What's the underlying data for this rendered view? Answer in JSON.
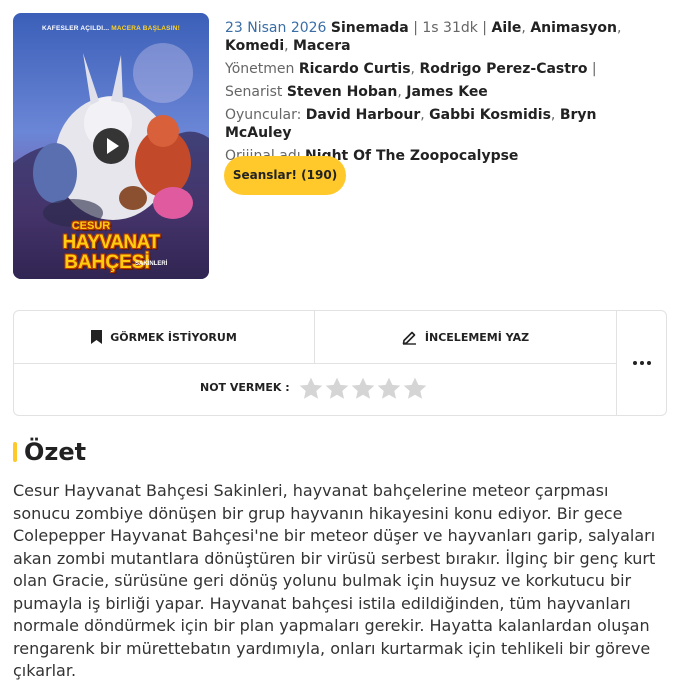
{
  "poster": {
    "tagline_part1": "KAFESLER AÇILDI...",
    "tagline_part2": "MACERA BAŞLASIN!",
    "title_line1": "CESUR",
    "title_line2": "HAYVANAT",
    "title_line3": "BAHÇESİ",
    "title_line4": "SAKİNLERİ"
  },
  "info": {
    "release_date": "23 Nisan 2026",
    "release_status": "Sinemada",
    "duration": "1s 31dk",
    "genres": [
      "Aile",
      "Animasyon",
      "Komedi",
      "Macera"
    ],
    "director_label": "Yönetmen",
    "directors": [
      "Ricardo Curtis",
      "Rodrigo Perez-Castro"
    ],
    "writer_label": "Senarist",
    "writers": [
      "Steven Hoban",
      "James Kee"
    ],
    "cast_label": "Oyuncular:",
    "cast": [
      "David Harbour",
      "Gabbi Kosmidis",
      "Bryn McAuley"
    ],
    "original_title_label": "Orijinal adı",
    "original_title": "Night Of The Zoopocalypse"
  },
  "seans_button": "Seanslar! (190)",
  "actions": {
    "watchlist": "GÖRMEK İSTİYORUM",
    "review": "İNCELEMEMİ YAZ",
    "rate_label": "NOT VERMEK :",
    "stars": 5
  },
  "summary": {
    "title": "Özet",
    "text": "Cesur Hayvanat Bahçesi Sakinleri, hayvanat bahçelerine meteor çarpması sonucu zombiye dönüşen bir grup hayvanın hikayesini konu ediyor. Bir gece Colepepper Hayvanat Bahçesi'ne bir meteor düşer ve hayvanları garip, salyaları akan zombi mutantlara dönüştüren bir virüsü serbest bırakır. İlginç bir genç kurt olan Gracie, sürüsüne geri dönüş yolunu bulmak için huysuz ve korkutucu bir pumayla iş birliği yapar. Hayvanat bahçesi istila edildiğinden, tüm hayvanları normale döndürmek için bir plan yapmaları gerekir. Hayatta kalanlardan oluşan rengarenk bir mürettebatın yardımıyla, onları kurtarmak için tehlikeli bir göreve çıkarlar."
  },
  "colors": {
    "accent": "#ffc92b",
    "date": "#3a6ea5",
    "star": "#d5d5d5"
  }
}
